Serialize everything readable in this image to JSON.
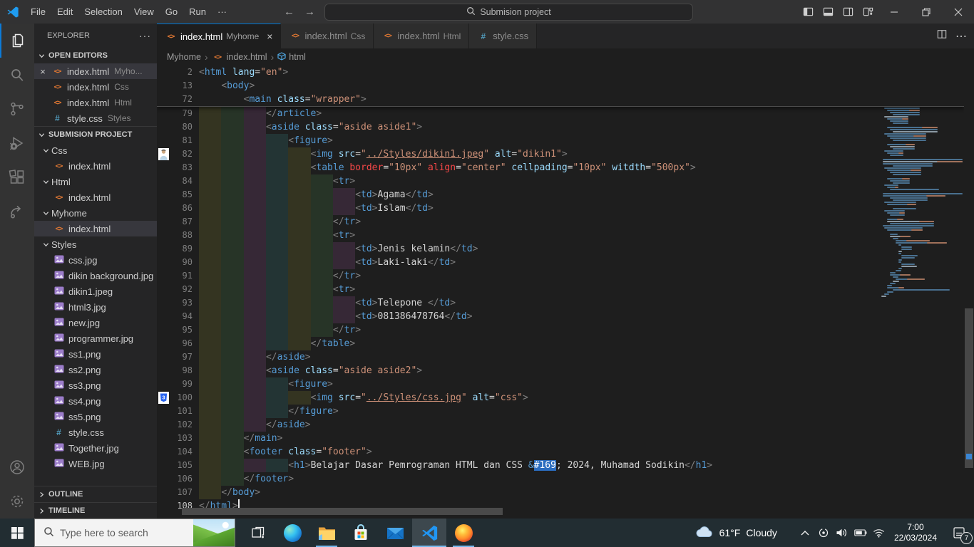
{
  "titlebar": {
    "menus": [
      "File",
      "Edit",
      "Selection",
      "View",
      "Go",
      "Run",
      "···"
    ],
    "nav": [
      "back-arrow",
      "forward-arrow"
    ],
    "command_center": "Submision project",
    "layout_buttons": [
      "toggle-sidebar",
      "toggle-panel",
      "toggle-secondary-sidebar",
      "customize-layout"
    ],
    "window_buttons": [
      "minimize",
      "restore",
      "close"
    ]
  },
  "activity_bar": {
    "items": [
      {
        "icon": "files",
        "active": true
      },
      {
        "icon": "search"
      },
      {
        "icon": "source-control"
      },
      {
        "icon": "run-debug"
      },
      {
        "icon": "extensions"
      },
      {
        "icon": "remote"
      }
    ],
    "bottom": [
      {
        "icon": "account"
      },
      {
        "icon": "settings-gear"
      }
    ]
  },
  "explorer": {
    "title": "EXPLORER",
    "title_more": "···",
    "open_editors": {
      "label": "OPEN EDITORS",
      "items": [
        {
          "icon": "html",
          "label": "index.html",
          "desc": "Myho...",
          "active": true,
          "close": "×"
        },
        {
          "icon": "html",
          "label": "index.html",
          "desc": "Css"
        },
        {
          "icon": "html",
          "label": "index.html",
          "desc": "Html"
        },
        {
          "icon": "css",
          "label": "style.css",
          "desc": "Styles"
        }
      ]
    },
    "project": {
      "label": "SUBMISION PROJECT",
      "tree": [
        {
          "type": "folder",
          "label": "Css"
        },
        {
          "type": "file",
          "icon": "html",
          "label": "index.html"
        },
        {
          "type": "folder",
          "label": "Html"
        },
        {
          "type": "file",
          "icon": "html",
          "label": "index.html"
        },
        {
          "type": "folder",
          "label": "Myhome"
        },
        {
          "type": "file",
          "icon": "html",
          "label": "index.html",
          "selected": true
        },
        {
          "type": "folder",
          "label": "Styles"
        },
        {
          "type": "file",
          "icon": "image",
          "label": "css.jpg"
        },
        {
          "type": "file",
          "icon": "image",
          "label": "dikin background.jpg"
        },
        {
          "type": "file",
          "icon": "image",
          "label": "dikin1.jpeg"
        },
        {
          "type": "file",
          "icon": "image",
          "label": "html3.jpg"
        },
        {
          "type": "file",
          "icon": "image",
          "label": "new.jpg"
        },
        {
          "type": "file",
          "icon": "image",
          "label": "programmer.jpg"
        },
        {
          "type": "file",
          "icon": "image",
          "label": "ss1.png"
        },
        {
          "type": "file",
          "icon": "image",
          "label": "ss2.png"
        },
        {
          "type": "file",
          "icon": "image",
          "label": "ss3.png"
        },
        {
          "type": "file",
          "icon": "image",
          "label": "ss4.png"
        },
        {
          "type": "file",
          "icon": "image",
          "label": "ss5.png"
        },
        {
          "type": "file",
          "icon": "css",
          "label": "style.css"
        },
        {
          "type": "file",
          "icon": "image",
          "label": "Together.jpg"
        },
        {
          "type": "file",
          "icon": "image",
          "label": "WEB.jpg"
        }
      ]
    },
    "outline_label": "OUTLINE",
    "timeline_label": "TIMELINE"
  },
  "tabs": [
    {
      "icon": "html",
      "label": "index.html",
      "desc": "Myhome",
      "active": true,
      "close": "×"
    },
    {
      "icon": "html",
      "label": "index.html",
      "desc": "Css"
    },
    {
      "icon": "html",
      "label": "index.html",
      "desc": "Html"
    },
    {
      "icon": "css",
      "label": "style.css"
    }
  ],
  "breadcrumb": [
    {
      "label": "Myhome"
    },
    {
      "label": "index.html",
      "icon": "html"
    },
    {
      "label": "html",
      "icon": "symbol"
    }
  ],
  "editor": {
    "sticky": [
      {
        "n": 2,
        "i": 0,
        "tk": [
          [
            "p",
            "<"
          ],
          [
            "t",
            "html"
          ],
          [
            "x",
            " "
          ],
          [
            "a",
            "lang"
          ],
          [
            "o",
            "="
          ],
          [
            "s",
            "\"en\""
          ],
          [
            "p",
            ">"
          ]
        ]
      },
      {
        "n": 13,
        "i": 1,
        "tk": [
          [
            "p",
            "<"
          ],
          [
            "t",
            "body"
          ],
          [
            "p",
            ">"
          ]
        ]
      },
      {
        "n": 72,
        "i": 2,
        "tk": [
          [
            "p",
            "<"
          ],
          [
            "t",
            "main"
          ],
          [
            "x",
            " "
          ],
          [
            "a",
            "class"
          ],
          [
            "o",
            "="
          ],
          [
            "s",
            "\"wrapper\""
          ],
          [
            "p",
            ">"
          ]
        ]
      }
    ],
    "lines": [
      {
        "n": 79,
        "i": 3,
        "tk": [
          [
            "p",
            "</"
          ],
          [
            "t",
            "article"
          ],
          [
            "p",
            ">"
          ]
        ]
      },
      {
        "n": 80,
        "i": 3,
        "tk": [
          [
            "p",
            "<"
          ],
          [
            "t",
            "aside"
          ],
          [
            "x",
            " "
          ],
          [
            "a",
            "class"
          ],
          [
            "o",
            "="
          ],
          [
            "s",
            "\"aside aside1\""
          ],
          [
            "p",
            ">"
          ]
        ]
      },
      {
        "n": 81,
        "i": 4,
        "tk": [
          [
            "p",
            "<"
          ],
          [
            "t",
            "figure"
          ],
          [
            "p",
            ">"
          ]
        ]
      },
      {
        "n": 82,
        "i": 5,
        "glyph": "person-thumbnail",
        "tk": [
          [
            "p",
            "<"
          ],
          [
            "t",
            "img"
          ],
          [
            "x",
            " "
          ],
          [
            "a",
            "src"
          ],
          [
            "o",
            "="
          ],
          [
            "s",
            "\""
          ],
          [
            "sl",
            "../Styles/dikin1.jpeg"
          ],
          [
            "s",
            "\""
          ],
          [
            "x",
            " "
          ],
          [
            "a",
            "alt"
          ],
          [
            "o",
            "="
          ],
          [
            "s",
            "\"dikin1\""
          ],
          [
            "p",
            ">"
          ]
        ]
      },
      {
        "n": 83,
        "i": 5,
        "tk": [
          [
            "p",
            "<"
          ],
          [
            "t",
            "table"
          ],
          [
            "x",
            " "
          ],
          [
            "r",
            "border"
          ],
          [
            "o",
            "="
          ],
          [
            "s",
            "\"10px\""
          ],
          [
            "x",
            " "
          ],
          [
            "r",
            "align"
          ],
          [
            "o",
            "="
          ],
          [
            "s",
            "\"center\""
          ],
          [
            "x",
            " "
          ],
          [
            "a",
            "cellpading"
          ],
          [
            "o",
            "="
          ],
          [
            "s",
            "\"10px\""
          ],
          [
            "x",
            " "
          ],
          [
            "a",
            "witdth"
          ],
          [
            "o",
            "="
          ],
          [
            "s",
            "\"500px\""
          ],
          [
            "p",
            ">"
          ]
        ]
      },
      {
        "n": 84,
        "i": 6,
        "tk": [
          [
            "p",
            "<"
          ],
          [
            "t",
            "tr"
          ],
          [
            "p",
            ">"
          ]
        ]
      },
      {
        "n": 85,
        "i": 7,
        "tk": [
          [
            "p",
            "<"
          ],
          [
            "t",
            "td"
          ],
          [
            "p",
            ">"
          ],
          [
            "x",
            "Agama"
          ],
          [
            "p",
            "</"
          ],
          [
            "t",
            "td"
          ],
          [
            "p",
            ">"
          ]
        ]
      },
      {
        "n": 86,
        "i": 7,
        "tk": [
          [
            "p",
            "<"
          ],
          [
            "t",
            "td"
          ],
          [
            "p",
            ">"
          ],
          [
            "x",
            "Islam"
          ],
          [
            "p",
            "</"
          ],
          [
            "t",
            "td"
          ],
          [
            "p",
            ">"
          ]
        ]
      },
      {
        "n": 87,
        "i": 6,
        "tk": [
          [
            "p",
            "</"
          ],
          [
            "t",
            "tr"
          ],
          [
            "p",
            ">"
          ]
        ]
      },
      {
        "n": 88,
        "i": 6,
        "tk": [
          [
            "p",
            "<"
          ],
          [
            "t",
            "tr"
          ],
          [
            "p",
            ">"
          ]
        ]
      },
      {
        "n": 89,
        "i": 7,
        "tk": [
          [
            "p",
            "<"
          ],
          [
            "t",
            "td"
          ],
          [
            "p",
            ">"
          ],
          [
            "x",
            "Jenis kelamin"
          ],
          [
            "p",
            "</"
          ],
          [
            "t",
            "td"
          ],
          [
            "p",
            ">"
          ]
        ]
      },
      {
        "n": 90,
        "i": 7,
        "tk": [
          [
            "p",
            "<"
          ],
          [
            "t",
            "td"
          ],
          [
            "p",
            ">"
          ],
          [
            "x",
            "Laki-laki"
          ],
          [
            "p",
            "</"
          ],
          [
            "t",
            "td"
          ],
          [
            "p",
            ">"
          ]
        ]
      },
      {
        "n": 91,
        "i": 6,
        "tk": [
          [
            "p",
            "</"
          ],
          [
            "t",
            "tr"
          ],
          [
            "p",
            ">"
          ]
        ]
      },
      {
        "n": 92,
        "i": 6,
        "tk": [
          [
            "p",
            "<"
          ],
          [
            "t",
            "tr"
          ],
          [
            "p",
            ">"
          ]
        ]
      },
      {
        "n": 93,
        "i": 7,
        "tk": [
          [
            "p",
            "<"
          ],
          [
            "t",
            "td"
          ],
          [
            "p",
            ">"
          ],
          [
            "x",
            "Telepone "
          ],
          [
            "p",
            "</"
          ],
          [
            "t",
            "td"
          ],
          [
            "p",
            ">"
          ]
        ]
      },
      {
        "n": 94,
        "i": 7,
        "tk": [
          [
            "p",
            "<"
          ],
          [
            "t",
            "td"
          ],
          [
            "p",
            ">"
          ],
          [
            "x",
            "081386478764"
          ],
          [
            "p",
            "</"
          ],
          [
            "t",
            "td"
          ],
          [
            "p",
            ">"
          ]
        ]
      },
      {
        "n": 95,
        "i": 6,
        "tk": [
          [
            "p",
            "</"
          ],
          [
            "t",
            "tr"
          ],
          [
            "p",
            ">"
          ]
        ]
      },
      {
        "n": 96,
        "i": 5,
        "tk": [
          [
            "p",
            "</"
          ],
          [
            "t",
            "table"
          ],
          [
            "p",
            ">"
          ]
        ]
      },
      {
        "n": 97,
        "i": 3,
        "tk": [
          [
            "p",
            "</"
          ],
          [
            "t",
            "aside"
          ],
          [
            "p",
            ">"
          ]
        ]
      },
      {
        "n": 98,
        "i": 3,
        "tk": [
          [
            "p",
            "<"
          ],
          [
            "t",
            "aside"
          ],
          [
            "x",
            " "
          ],
          [
            "a",
            "class"
          ],
          [
            "o",
            "="
          ],
          [
            "s",
            "\"aside aside2\""
          ],
          [
            "p",
            ">"
          ]
        ]
      },
      {
        "n": 99,
        "i": 4,
        "tk": [
          [
            "p",
            "<"
          ],
          [
            "t",
            "figure"
          ],
          [
            "p",
            ">"
          ]
        ]
      },
      {
        "n": 100,
        "i": 5,
        "glyph": "css3-thumbnail",
        "tk": [
          [
            "p",
            "<"
          ],
          [
            "t",
            "img"
          ],
          [
            "x",
            " "
          ],
          [
            "a",
            "src"
          ],
          [
            "o",
            "="
          ],
          [
            "s",
            "\""
          ],
          [
            "sl",
            "../Styles/css.jpg"
          ],
          [
            "s",
            "\""
          ],
          [
            "x",
            " "
          ],
          [
            "a",
            "alt"
          ],
          [
            "o",
            "="
          ],
          [
            "s",
            "\"css\""
          ],
          [
            "p",
            ">"
          ]
        ]
      },
      {
        "n": 101,
        "i": 4,
        "tk": [
          [
            "p",
            "</"
          ],
          [
            "t",
            "figure"
          ],
          [
            "p",
            ">"
          ]
        ]
      },
      {
        "n": 102,
        "i": 3,
        "tk": [
          [
            "p",
            "</"
          ],
          [
            "t",
            "aside"
          ],
          [
            "p",
            ">"
          ]
        ]
      },
      {
        "n": 103,
        "i": 2,
        "tk": [
          [
            "p",
            "</"
          ],
          [
            "t",
            "main"
          ],
          [
            "p",
            ">"
          ]
        ]
      },
      {
        "n": 104,
        "i": 2,
        "tk": [
          [
            "p",
            "<"
          ],
          [
            "t",
            "footer"
          ],
          [
            "x",
            " "
          ],
          [
            "a",
            "class"
          ],
          [
            "o",
            "="
          ],
          [
            "s",
            "\"footer\""
          ],
          [
            "p",
            ">"
          ]
        ]
      },
      {
        "n": 105,
        "i": 4,
        "tk": [
          [
            "p",
            "<"
          ],
          [
            "t",
            "h1"
          ],
          [
            "p",
            ">"
          ],
          [
            "x",
            "Belajar Dasar Pemrograman HTML dan CSS "
          ],
          [
            "e",
            "&"
          ],
          [
            "sel",
            "#169"
          ],
          [
            "x",
            "; 2024, Muhamad Sodikin"
          ],
          [
            "p",
            "</"
          ],
          [
            "t",
            "h1"
          ],
          [
            "p",
            ">"
          ]
        ]
      },
      {
        "n": 106,
        "i": 2,
        "tk": [
          [
            "p",
            "</"
          ],
          [
            "t",
            "footer"
          ],
          [
            "p",
            ">"
          ]
        ]
      },
      {
        "n": 107,
        "i": 1,
        "tk": [
          [
            "p",
            "</"
          ],
          [
            "t",
            "body"
          ],
          [
            "p",
            ">"
          ]
        ]
      },
      {
        "n": 108,
        "i": 0,
        "cursor": true,
        "tk": [
          [
            "p",
            "</"
          ],
          [
            "t",
            "html"
          ],
          [
            "p",
            ">"
          ]
        ]
      }
    ],
    "total_lines": 108
  },
  "taskbar": {
    "search_placeholder": "Type here to search",
    "apps": [
      {
        "icon": "task-view"
      },
      {
        "icon": "edge"
      },
      {
        "icon": "file-explorer",
        "running": true
      },
      {
        "icon": "store"
      },
      {
        "icon": "mail"
      },
      {
        "icon": "vscode",
        "running": true,
        "active": true
      },
      {
        "icon": "firefox",
        "running": true
      }
    ],
    "weather": {
      "temp": "61°F",
      "condition": "Cloudy"
    },
    "tray_icons": [
      "chevron-up",
      "tray-app",
      "speaker",
      "battery",
      "wifi"
    ],
    "clock": {
      "time": "7:00",
      "date": "22/03/2024"
    },
    "action_center_badge": "7"
  },
  "colors": {
    "accent": "#0078d4",
    "selection": "#2b6dbf",
    "tag": "#569cd6",
    "attribute": "#9cdcfe",
    "attribute_deprecated": "#f44747",
    "string": "#ce9178",
    "punctuation": "#808080",
    "text": "#d4d4d4",
    "taskbar_underline": "#76b9ed"
  }
}
